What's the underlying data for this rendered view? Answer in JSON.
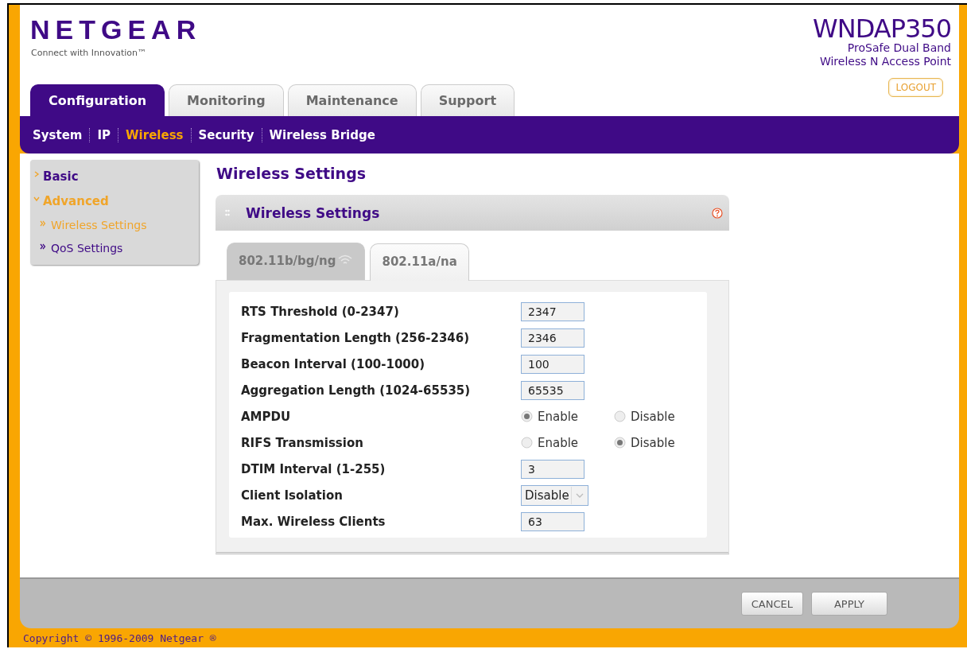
{
  "header": {
    "logo": "NETGEAR",
    "tagline": "Connect with Innovation™",
    "model": "WNDAP350",
    "product_line_1": "ProSafe Dual Band",
    "product_line_2": "Wireless N Access Point",
    "logout": "LOGOUT"
  },
  "main_tabs": [
    {
      "label": "Configuration",
      "selected": true
    },
    {
      "label": "Monitoring",
      "selected": false
    },
    {
      "label": "Maintenance",
      "selected": false
    },
    {
      "label": "Support",
      "selected": false
    }
  ],
  "sub_nav": [
    {
      "label": "System",
      "selected": false
    },
    {
      "label": "IP",
      "selected": false
    },
    {
      "label": "Wireless",
      "selected": true
    },
    {
      "label": "Security",
      "selected": false
    },
    {
      "label": "Wireless Bridge",
      "selected": false
    }
  ],
  "sidebar": [
    {
      "label": "Basic",
      "expanded": false,
      "selected": false
    },
    {
      "label": "Advanced",
      "expanded": true,
      "selected": true,
      "children": [
        {
          "label": "Wireless Settings",
          "selected": true
        },
        {
          "label": "QoS Settings",
          "selected": false
        }
      ]
    }
  ],
  "page_title": "Wireless Settings",
  "panel": {
    "title": "Wireless Settings"
  },
  "band_tabs": [
    {
      "label": "802.11b/bg/ng",
      "selected": false,
      "signal_icon": true
    },
    {
      "label": "802.11a/na",
      "selected": true,
      "signal_icon": false
    }
  ],
  "settings": [
    {
      "kind": "text",
      "label": "RTS Threshold (0-2347)",
      "value": "2347"
    },
    {
      "kind": "text",
      "label": "Fragmentation Length (256-2346)",
      "value": "2346"
    },
    {
      "kind": "text",
      "label": "Beacon Interval (100-1000)",
      "value": "100"
    },
    {
      "kind": "text",
      "label": "Aggregation Length (1024-65535)",
      "value": "65535"
    },
    {
      "kind": "radio",
      "label": "AMPDU",
      "options": [
        {
          "label": "Enable",
          "selected": true
        },
        {
          "label": "Disable",
          "selected": false
        }
      ]
    },
    {
      "kind": "radio",
      "label": "RIFS Transmission",
      "options": [
        {
          "label": "Enable",
          "selected": false
        },
        {
          "label": "Disable",
          "selected": true
        }
      ]
    },
    {
      "kind": "text",
      "label": "DTIM Interval (1-255)",
      "value": "3"
    },
    {
      "kind": "select",
      "label": "Client Isolation",
      "value": "Disable"
    },
    {
      "kind": "text",
      "label": "Max. Wireless Clients",
      "value": "63"
    }
  ],
  "footer_buttons": [
    "CANCEL",
    "APPLY"
  ],
  "copyright": "Copyright © 1996-2009 Netgear ®"
}
